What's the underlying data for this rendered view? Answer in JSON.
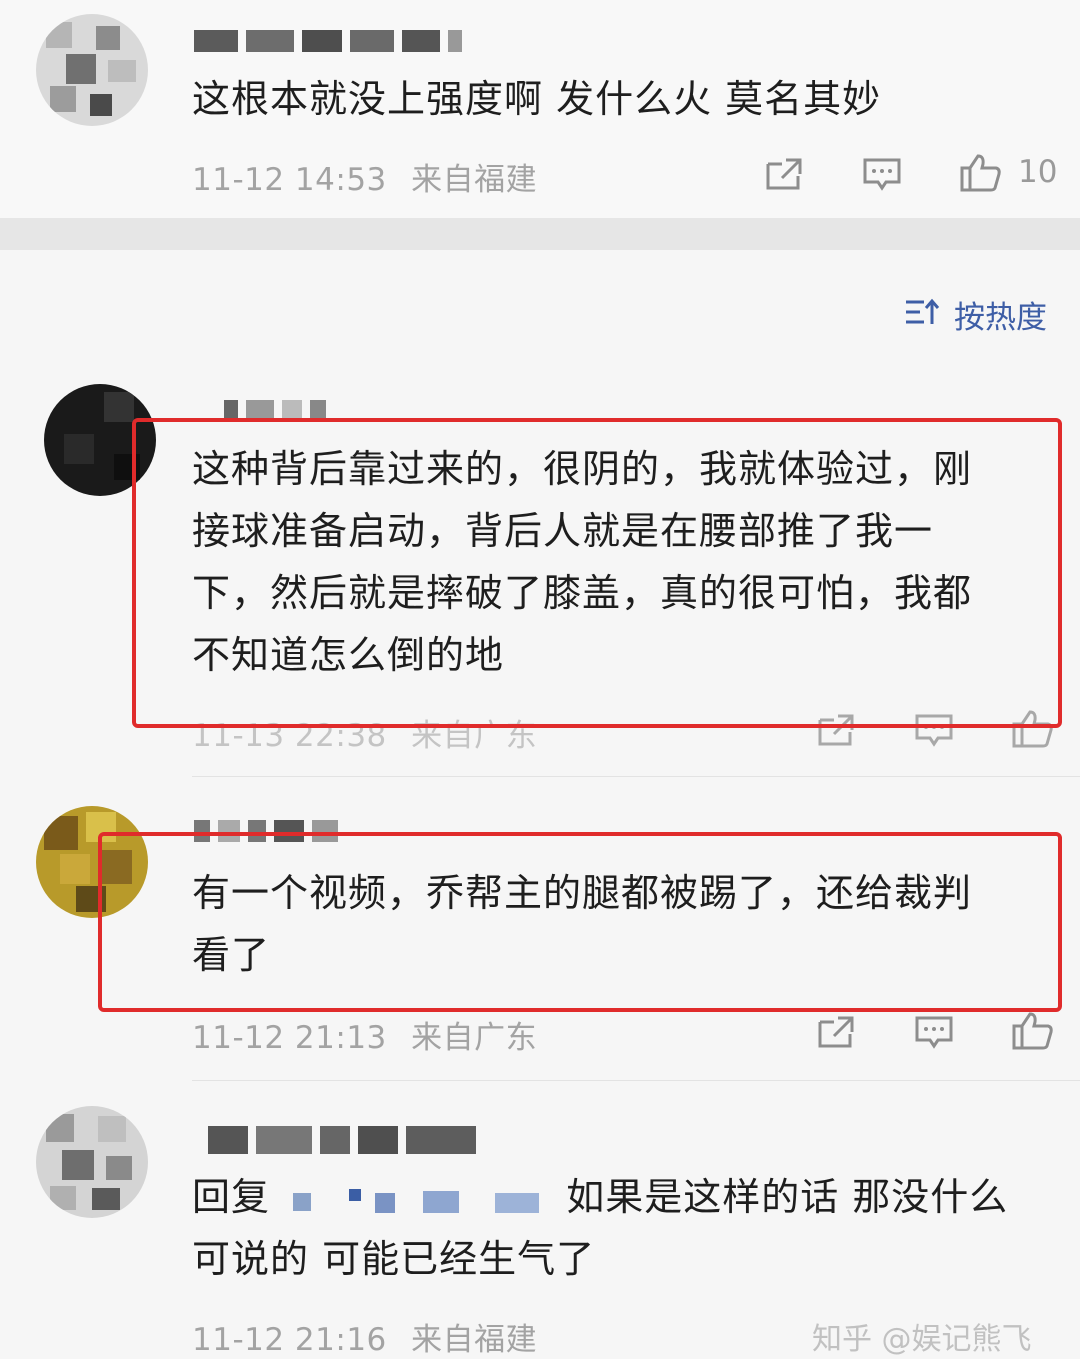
{
  "sort": {
    "label": "按热度",
    "icon": "sort-hot-icon"
  },
  "comments": [
    {
      "text_lines": [
        "这根本就没上强度啊 发什么火 莫名其妙"
      ],
      "time": "11-12 14:53",
      "location": "来自福建",
      "likes": "10"
    },
    {
      "text_lines": [
        "这种背后靠过来的，很阴的，我就体验过，刚",
        "接球准备启动，背后人就是在腰部推了我一",
        "下，然后就是摔破了膝盖，真的很可怕，我都",
        "不知道怎么倒的地"
      ],
      "time": "11-13 22:38",
      "location": "来自广东",
      "likes": ""
    },
    {
      "text_lines": [
        "有一个视频，乔帮主的腿都被踢了，还给裁判",
        "看了"
      ],
      "time": "11-12 21:13",
      "location": "来自广东",
      "likes": ""
    },
    {
      "reply_prefix": "回复",
      "text_lines": [
        "如果是这样的话 那没什么",
        "可说的 可能已经生气了"
      ],
      "time": "11-12 21:16",
      "location": "来自福建",
      "likes": ""
    }
  ],
  "watermark": "知乎 @娱记熊飞",
  "colors": {
    "highlight_box": "#e02b2b",
    "sort_accent": "#3e5ea6",
    "meta_text": "#a3a3a3"
  }
}
